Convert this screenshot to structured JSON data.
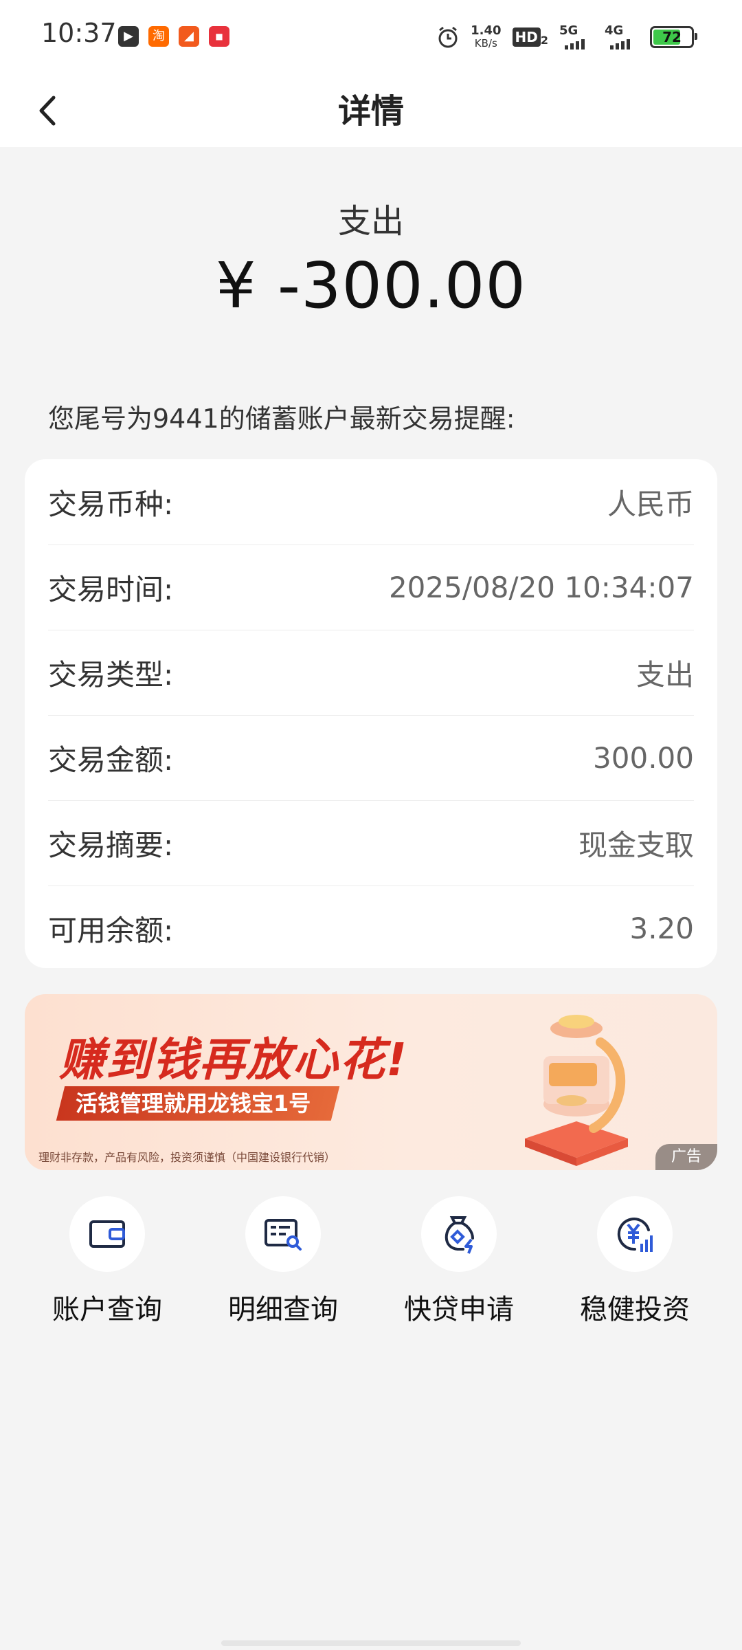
{
  "status_bar": {
    "time": "10:37",
    "network_speed": "1.40",
    "network_speed_unit": "KB/s",
    "hd_label": "HD",
    "hd_sub": "2",
    "net1": "5G",
    "net2": "4G",
    "battery": "72",
    "battery_level": 0.72,
    "icons": [
      "video-app-icon",
      "taobao-app-icon",
      "feishu-app-icon",
      "news-app-icon",
      "alarm-icon"
    ]
  },
  "nav": {
    "title": "详情",
    "back_icon": "chevron-left-icon"
  },
  "summary": {
    "type": "支出",
    "amount": "¥ -300.00"
  },
  "notice": "您尾号为9441的储蓄账户最新交易提醒:",
  "details": [
    {
      "label": "交易币种:",
      "value": "人民币"
    },
    {
      "label": "交易时间:",
      "value": "2025/08/20 10:34:07"
    },
    {
      "label": "交易类型:",
      "value": "支出"
    },
    {
      "label": "交易金额:",
      "value": "300.00"
    },
    {
      "label": "交易摘要:",
      "value": "现金支取"
    },
    {
      "label": "可用余额:",
      "value": "3.20"
    }
  ],
  "ad": {
    "headline": "赚到钱再放心花!",
    "subline": "活钱管理就用龙钱宝1号",
    "disclaimer": "理财非存款，产品有风险，投资须谨慎（中国建设银行代销）",
    "tag": "广告"
  },
  "quick_actions": [
    {
      "label": "账户查询",
      "icon": "wallet-icon"
    },
    {
      "label": "明细查询",
      "icon": "statement-search-icon"
    },
    {
      "label": "快贷申请",
      "icon": "loan-bag-icon"
    },
    {
      "label": "稳健投资",
      "icon": "yuan-chart-icon"
    }
  ],
  "colors": {
    "accent_red": "#d62a1e",
    "icon_dark": "#1f2a44",
    "icon_blue": "#2f5bd8",
    "background": "#f4f4f4"
  }
}
